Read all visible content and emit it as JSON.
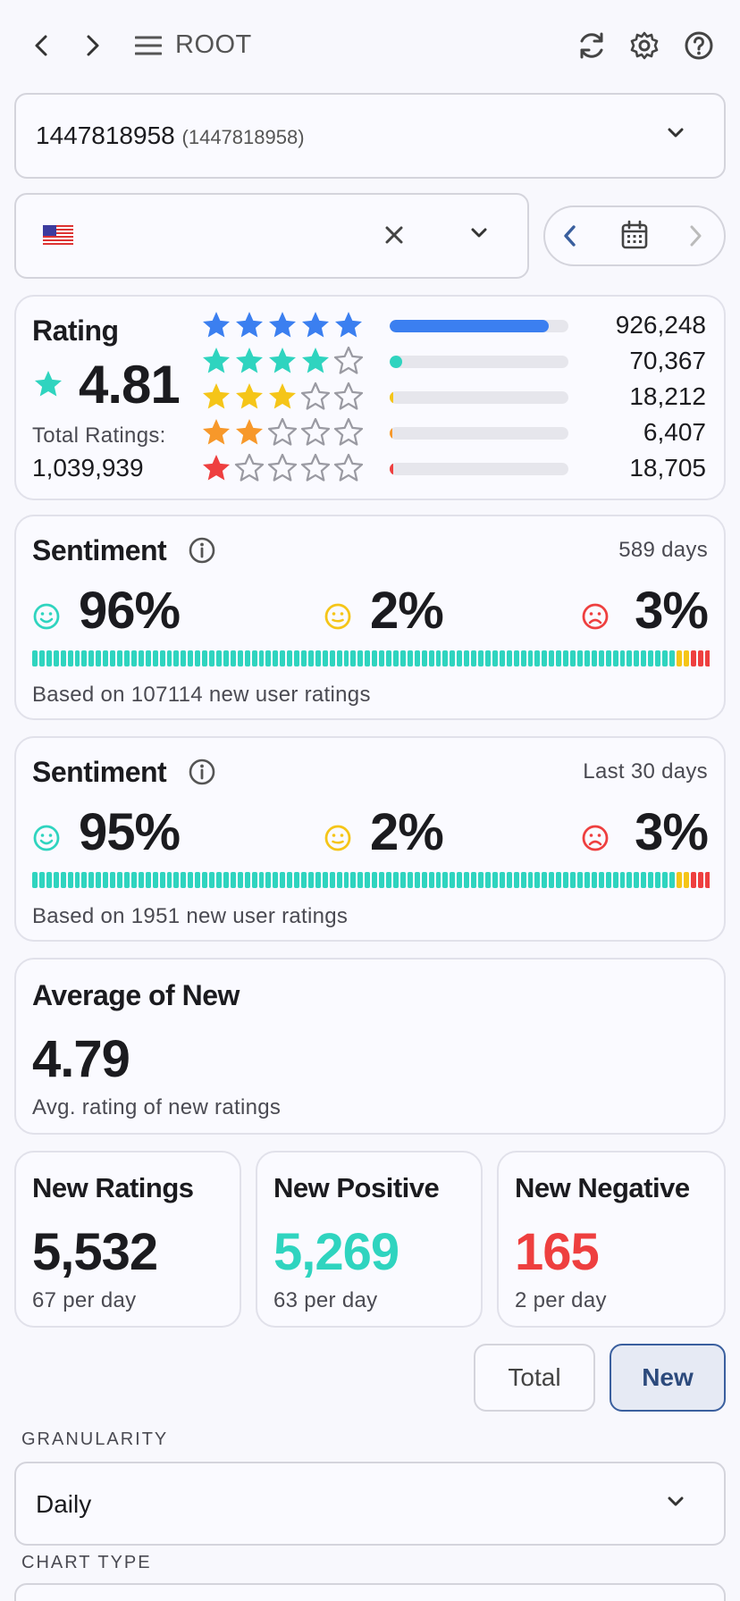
{
  "nav": {
    "title": "ROOT"
  },
  "app_select": {
    "value": "1447818958",
    "id_suffix": "(1447818958)"
  },
  "country": {
    "flag_label": "US"
  },
  "rating": {
    "title": "Rating",
    "score": "4.81",
    "total_label": "Total Ratings:",
    "total_value": "1,039,939",
    "rows": [
      {
        "stars": 5,
        "count": "926,248",
        "fraction": 0.89,
        "color": "#3b7ff0"
      },
      {
        "stars": 4,
        "count": "70,367",
        "fraction": 0.068,
        "color": "#2fd4bf"
      },
      {
        "stars": 3,
        "count": "18,212",
        "fraction": 0.018,
        "color": "#f5c518"
      },
      {
        "stars": 2,
        "count": "6,407",
        "fraction": 0.006,
        "color": "#f7982a"
      },
      {
        "stars": 1,
        "count": "18,705",
        "fraction": 0.018,
        "color": "#ee3f3f"
      }
    ]
  },
  "sentiment_all": {
    "title": "Sentiment",
    "period": "589 days",
    "positive": "96%",
    "neutral": "2%",
    "negative": "3%",
    "positive_fraction": 0.96,
    "neutral_fraction": 0.02,
    "negative_fraction": 0.03,
    "footer": "Based on 107114 new user ratings"
  },
  "sentiment_30": {
    "title": "Sentiment",
    "period": "Last 30 days",
    "positive": "95%",
    "neutral": "2%",
    "negative": "3%",
    "positive_fraction": 0.95,
    "neutral_fraction": 0.02,
    "negative_fraction": 0.03,
    "footer": "Based on 1951 new user ratings"
  },
  "average_new": {
    "title": "Average of New",
    "value": "4.79",
    "caption": "Avg. rating of new ratings"
  },
  "stats": [
    {
      "title": "New Ratings",
      "value": "5,532",
      "caption": "67 per day",
      "color": "#1b1b1f"
    },
    {
      "title": "New Positive",
      "value": "5,269",
      "caption": "63 per day",
      "color": "#2fd4bf"
    },
    {
      "title": "New Negative",
      "value": "165",
      "caption": "2 per day",
      "color": "#ee3f3f"
    }
  ],
  "toggle": {
    "total_label": "Total",
    "new_label": "New",
    "selected": "New"
  },
  "granularity": {
    "label": "GRANULARITY",
    "value": "Daily"
  },
  "chart_type": {
    "label": "CHART TYPE"
  },
  "colors": {
    "positive": "#2fd4bf",
    "neutral": "#f5c518",
    "negative": "#ee3f3f",
    "accent": "#3b7ff0"
  }
}
